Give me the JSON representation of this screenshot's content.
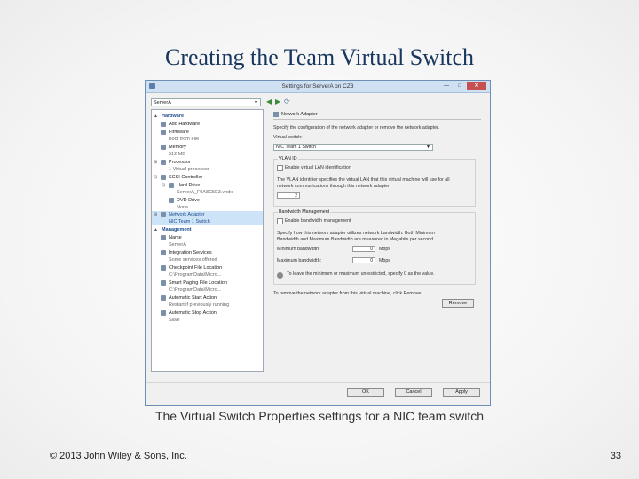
{
  "slide": {
    "title": "Creating the Team Virtual Switch",
    "caption": "The Virtual Switch Properties settings for a NIC team switch",
    "footer_left": "© 2013 John Wiley & Sons, Inc.",
    "page_number": "33"
  },
  "window": {
    "title": "Settings for ServerA on CZ3",
    "minimize_glyph": "—",
    "maximize_glyph": "□",
    "close_glyph": "✕",
    "vm_selector": "ServerA",
    "nav_back": "◀",
    "nav_forward": "▶",
    "nav_refresh": "⟳"
  },
  "tree": {
    "hardware": "Hardware",
    "add_hardware": "Add Hardware",
    "firmware": "Firmware",
    "firmware_sub": "Boot from File",
    "memory": "Memory",
    "memory_sub": "512 MB",
    "processor": "Processor",
    "processor_sub": "1 Virtual processor",
    "scsi": "SCSI Controller",
    "hard_drive": "Hard Drive",
    "hard_drive_sub": "ServerA_F0A8C5E3.vhdx",
    "dvd": "DVD Drive",
    "dvd_sub": "None",
    "network_adapter": "Network Adapter",
    "network_adapter_sub": "NIC Team 1 Switch",
    "management": "Management",
    "name": "Name",
    "name_sub": "ServerA",
    "integration": "Integration Services",
    "integration_sub": "Some services offered",
    "checkpoint": "Checkpoint File Location",
    "checkpoint_sub": "C:\\ProgramData\\Micro...",
    "paging": "Smart Paging File Location",
    "paging_sub": "C:\\ProgramData\\Micro...",
    "auto_start": "Automatic Start Action",
    "auto_start_sub": "Restart if previously running",
    "auto_stop": "Automatic Stop Action",
    "auto_stop_sub": "Save"
  },
  "pane": {
    "heading": "Network Adapter",
    "intro": "Specify the configuration of the network adapter or remove the network adapter.",
    "switch_label": "Virtual switch:",
    "switch_value": "NIC Team 1 Switch",
    "vlan_group": "VLAN ID",
    "vlan_checkbox": "Enable virtual LAN identification",
    "vlan_desc1": "The VLAN identifier specifies the virtual LAN that this virtual machine will use for all",
    "vlan_desc2": "network communications through this network adapter.",
    "vlan_value": "2",
    "bw_group": "Bandwidth Management",
    "bw_checkbox": "Enable bandwidth management",
    "bw_desc1": "Specify how this network adapter utilizes network bandwidth. Both Minimum",
    "bw_desc2": "Bandwidth and Maximum Bandwidth are measured in Megabits per second.",
    "min_label": "Minimum bandwidth:",
    "min_value": "0",
    "max_label": "Maximum bandwidth:",
    "max_value": "0",
    "unit": "Mbps",
    "info_note": "To leave the minimum or maximum unrestricted, specify 0 as the value.",
    "info_glyph": "i",
    "remove_note": "To remove the network adapter from this virtual machine, click Remove.",
    "remove_button": "Remove"
  },
  "buttons": {
    "ok": "OK",
    "cancel": "Cancel",
    "apply": "Apply"
  },
  "colors": {
    "title_text": "#17375e",
    "titlebar": "#cfe0f3",
    "selection": "#cde3f7",
    "category_text": "#1f4e8c",
    "close_button": "#c75050"
  }
}
